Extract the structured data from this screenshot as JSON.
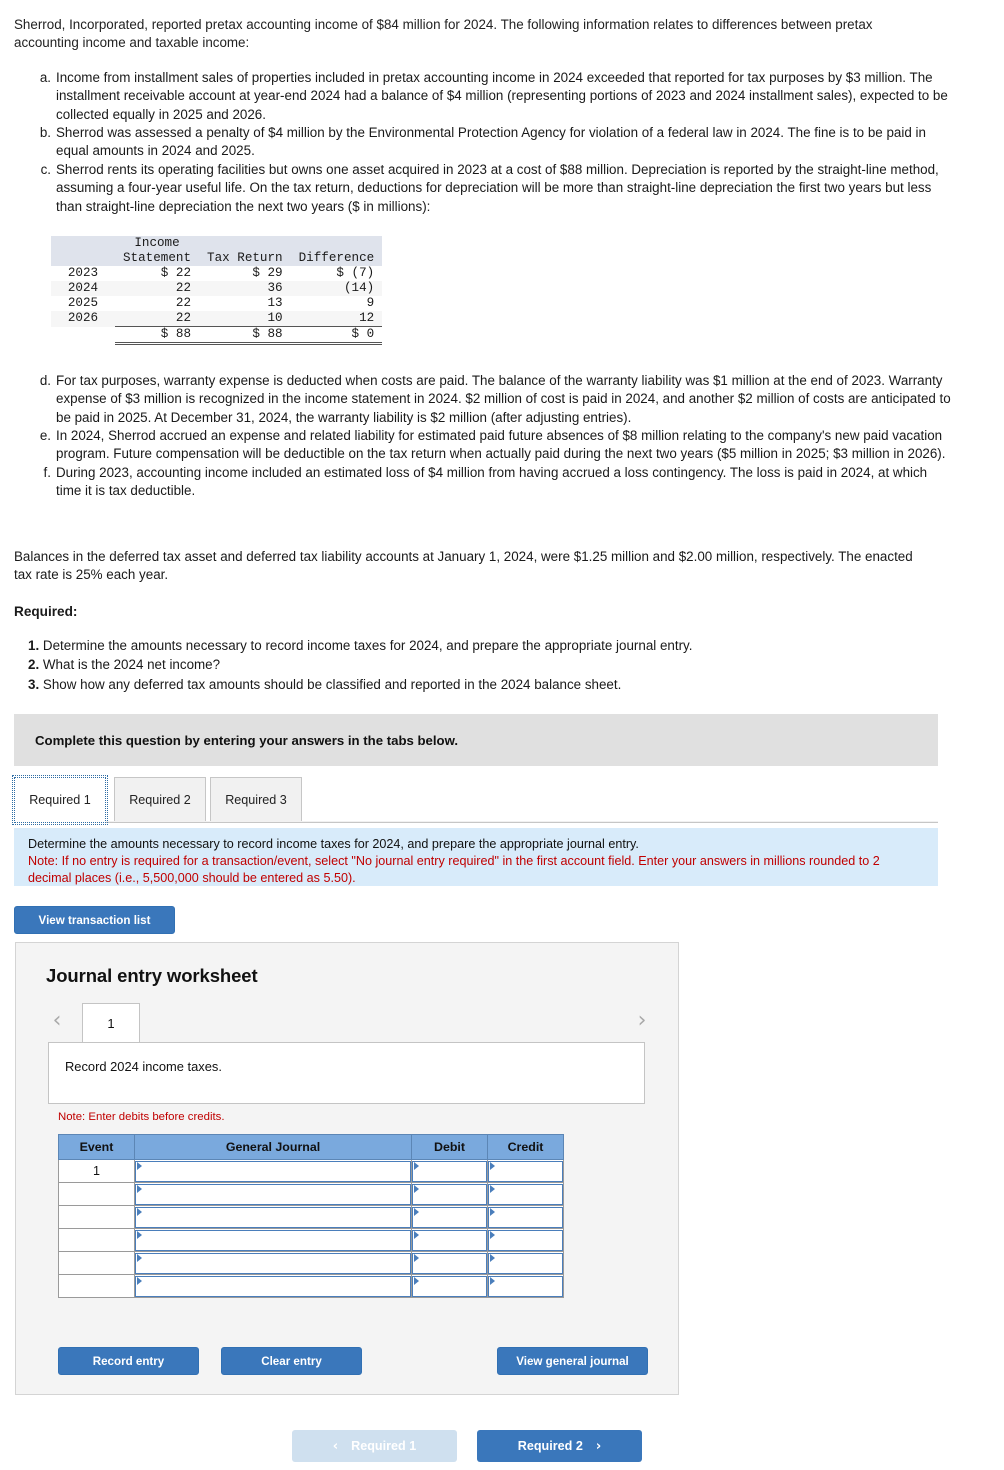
{
  "intro": {
    "paragraph": "Sherrod, Incorporated, reported pretax accounting income of $84 million for 2024. The following information relates to differences between pretax accounting income and taxable income:"
  },
  "items_top": [
    {
      "marker": "a.",
      "text": "Income from installment sales of properties included in pretax accounting income in 2024 exceeded that reported for tax purposes by $3 million. The installment receivable account at year-end 2024 had a balance of $4 million (representing portions of 2023 and 2024 installment sales), expected to be collected equally in 2025 and 2026."
    },
    {
      "marker": "b.",
      "text": "Sherrod was assessed a penalty of $4 million by the Environmental Protection Agency for violation of a federal law in 2024. The fine is to be paid in equal amounts in 2024 and 2025."
    },
    {
      "marker": "c.",
      "text": "Sherrod rents its operating facilities but owns one asset acquired in 2023 at a cost of $88 million. Depreciation is reported by the straight-line method, assuming a four-year useful life. On the tax return, deductions for depreciation will be more than straight-line depreciation the first two years but less than straight-line depreciation the next two years ($ in millions):"
    }
  ],
  "depreciation_table": {
    "headers": [
      "",
      "Income Statement",
      "Tax Return",
      "Difference"
    ],
    "header_line1": [
      "",
      "Income",
      "",
      ""
    ],
    "header_line2": [
      "",
      "Statement",
      "Tax Return",
      "Difference"
    ],
    "rows": [
      {
        "year": "2023",
        "income_statement": "$ 22",
        "tax_return": "$ 29",
        "difference": "$ (7)"
      },
      {
        "year": "2024",
        "income_statement": "22",
        "tax_return": "36",
        "difference": "(14)"
      },
      {
        "year": "2025",
        "income_statement": "22",
        "tax_return": "13",
        "difference": "9"
      },
      {
        "year": "2026",
        "income_statement": "22",
        "tax_return": "10",
        "difference": "12"
      }
    ],
    "total": {
      "year": "",
      "income_statement": "$ 88",
      "tax_return": "$ 88",
      "difference": "$ 0"
    }
  },
  "items_bottom": [
    {
      "marker": "d.",
      "text": "For tax purposes, warranty expense is deducted when costs are paid. The balance of the warranty liability was $1 million at the end of 2023. Warranty expense of $3 million is recognized in the income statement in 2024. $2 million of cost is paid in 2024, and another $2 million of costs are anticipated to be paid in 2025. At December 31, 2024, the warranty liability is $2 million (after adjusting entries)."
    },
    {
      "marker": "e.",
      "text": "In 2024, Sherrod accrued an expense and related liability for estimated paid future absences of $8 million relating to the company's new paid vacation program. Future compensation will be deductible on the tax return when actually paid during the next two years ($5 million in 2025; $3 million in 2026)."
    },
    {
      "marker": "f.",
      "text": "During 2023, accounting income included an estimated loss of $4 million from having accrued a loss contingency. The loss is paid in 2024, at which time it is tax deductible."
    }
  ],
  "balances": {
    "text": "Balances in the deferred tax asset and deferred tax liability accounts at January 1, 2024, were $1.25 million and $2.00 million, respectively. The enacted tax rate is 25% each year."
  },
  "required": {
    "heading": "Required:",
    "items": [
      {
        "num": "1.",
        "text": "Determine the amounts necessary to record income taxes for 2024, and prepare the appropriate journal entry."
      },
      {
        "num": "2.",
        "text": "What is the 2024 net income?"
      },
      {
        "num": "3.",
        "text": "Show how any deferred tax amounts should be classified and reported in the 2024 balance sheet."
      }
    ]
  },
  "complete_bar": {
    "text": "Complete this question by entering your answers in the tabs below."
  },
  "tabs": [
    {
      "label": "Required 1",
      "active": true
    },
    {
      "label": "Required 2",
      "active": false
    },
    {
      "label": "Required 3",
      "active": false
    }
  ],
  "instruction_panel": {
    "line1": "Determine the amounts necessary to record income taxes for 2024, and prepare the appropriate journal entry.",
    "note": "Note: If no entry is required for a transaction/event, select \"No journal entry required\" in the first account field. Enter your answers in millions rounded to 2 decimal places (i.e., 5,500,000 should be entered as 5.50)."
  },
  "buttons": {
    "view_transaction_list": "View transaction list",
    "record_entry": "Record entry",
    "clear_entry": "Clear entry",
    "view_general_journal": "View general journal"
  },
  "worksheet": {
    "title": "Journal entry worksheet",
    "page_tab": "1",
    "prev_arrow": "‹",
    "next_arrow": "›",
    "description": "Record 2024 income taxes.",
    "note": "Note: Enter debits before credits.",
    "table": {
      "headers": [
        "Event",
        "General Journal",
        "Debit",
        "Credit"
      ],
      "rows": [
        {
          "event": "1",
          "general_journal": "",
          "debit": "",
          "credit": ""
        },
        {
          "event": "",
          "general_journal": "",
          "debit": "",
          "credit": ""
        },
        {
          "event": "",
          "general_journal": "",
          "debit": "",
          "credit": ""
        },
        {
          "event": "",
          "general_journal": "",
          "debit": "",
          "credit": ""
        },
        {
          "event": "",
          "general_journal": "",
          "debit": "",
          "credit": ""
        },
        {
          "event": "",
          "general_journal": "",
          "debit": "",
          "credit": ""
        }
      ]
    }
  },
  "footer_nav": {
    "prev_label": "Required 1",
    "prev_arrow": "‹",
    "next_label": "Required 2",
    "next_arrow": "›"
  },
  "colors": {
    "primary_blue": "#3a77bb",
    "table_header_blue": "#7aa9dd",
    "panel_blue": "#d8ebfa",
    "note_red": "#c00000",
    "gray_bar": "#e0e0e0"
  }
}
